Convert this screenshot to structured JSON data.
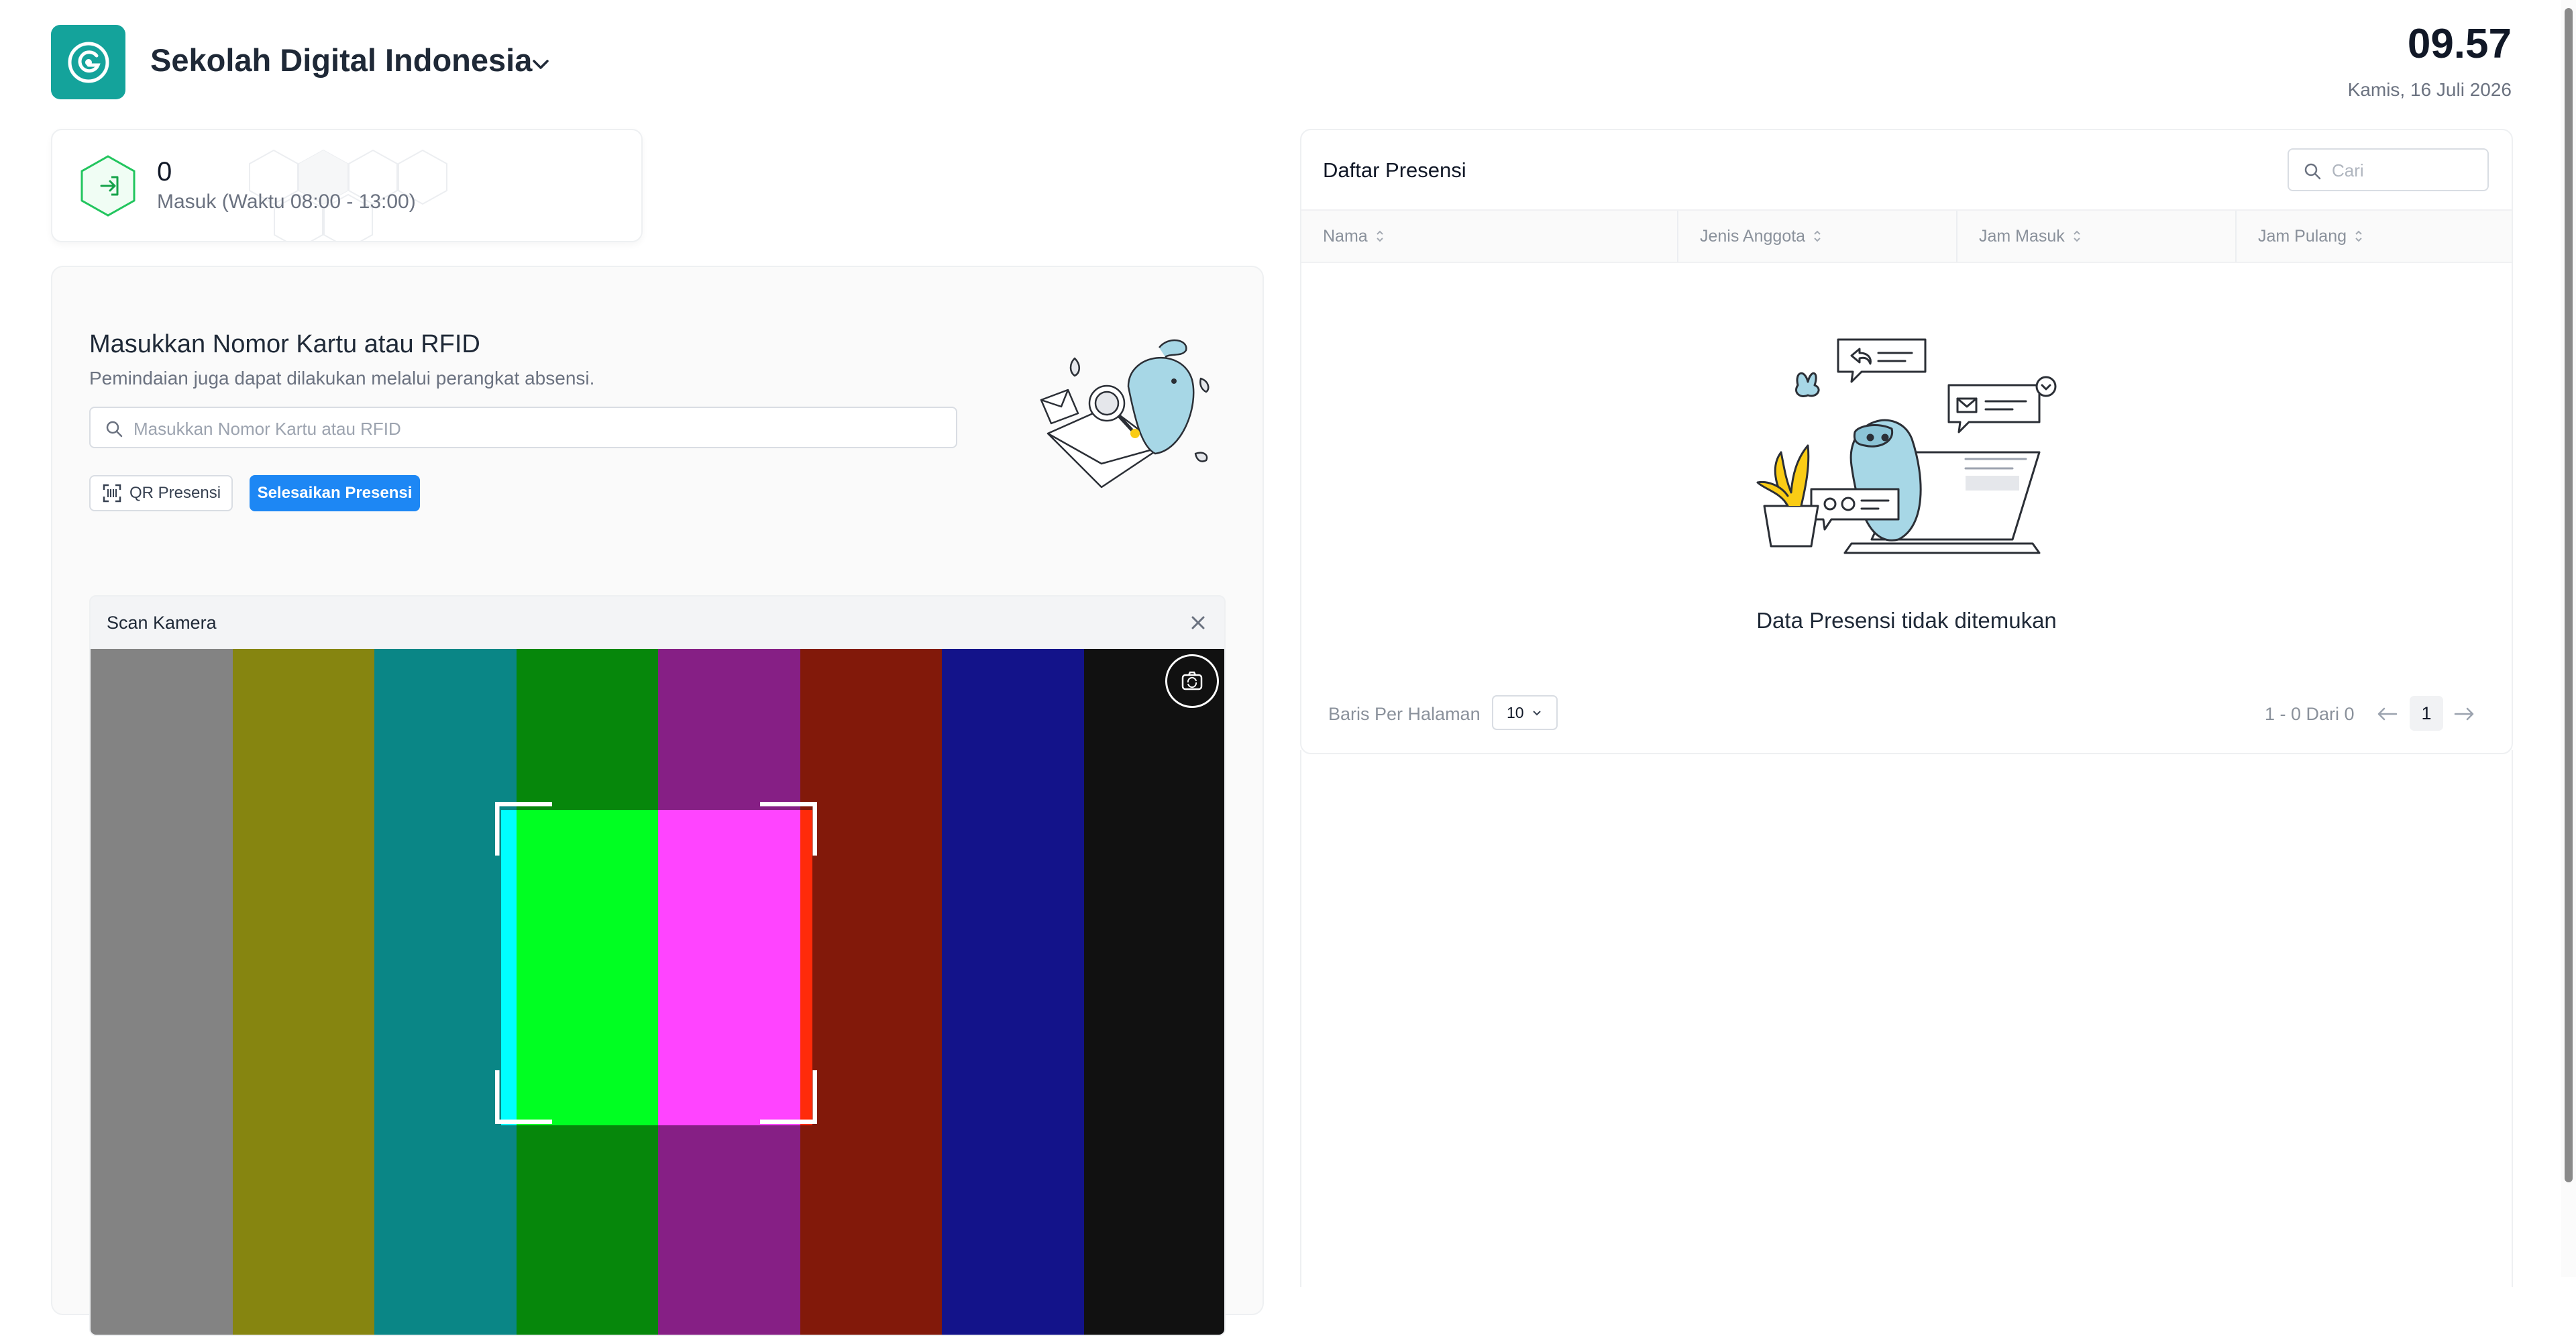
{
  "header": {
    "school_name": "Sekolah Digital Indonesia",
    "time": "09.57",
    "date": "Kamis, 16 Juli 2026",
    "logo_color": "#14a39b"
  },
  "stat": {
    "count": "0",
    "label": "Masuk (Waktu 08:00 - 13:00)",
    "icon": "enter-hexagon-icon",
    "accent": "#22c55e"
  },
  "input_card": {
    "title": "Masukkan Nomor Kartu atau RFID",
    "subtitle": "Pemindaian juga dapat dilakukan melalui perangkat absensi.",
    "input_value": "",
    "input_placeholder": "Masukkan Nomor Kartu atau RFID",
    "qr_button_label": "QR Presensi",
    "finish_button_label": "Selesaikan Presensi",
    "primary_color": "#1d87f4"
  },
  "camera": {
    "title": "Scan Kamera",
    "bar_colors": [
      "#838383",
      "#868510",
      "#0a8686",
      "#06870b",
      "#861f85",
      "#82190a",
      "#13138a",
      "#111111"
    ],
    "inner_colors": [
      "#00ffff",
      "#00ff22",
      "#ff44ff",
      "#ff2b0a"
    ]
  },
  "attendance": {
    "title": "Daftar Presensi",
    "search_value": "",
    "search_placeholder": "Cari",
    "columns": [
      "Nama",
      "Jenis Anggota",
      "Jam Masuk",
      "Jam Pulang"
    ],
    "rows": [],
    "empty_text": "Data Presensi tidak ditemukan",
    "rows_per_page_label": "Baris Per Halaman",
    "rows_per_page": "10",
    "range_text": "1 - 0 Dari 0",
    "current_page": "1"
  }
}
